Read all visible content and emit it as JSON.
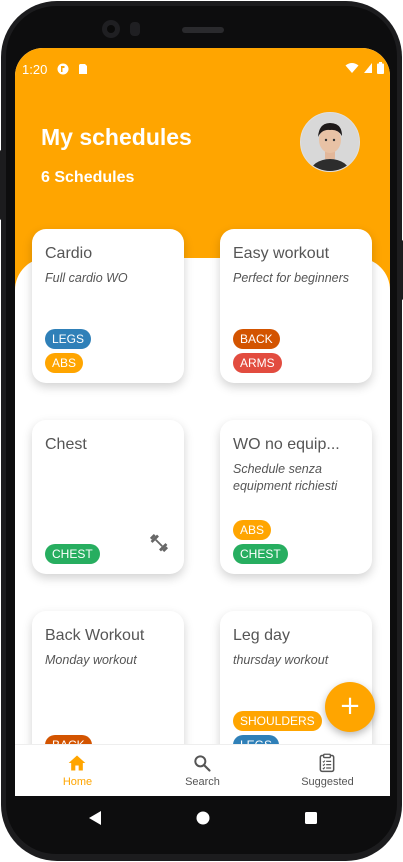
{
  "status_bar": {
    "time": "1:20"
  },
  "header": {
    "title": "My schedules",
    "subtitle": "6 Schedules"
  },
  "cards": [
    {
      "title": "Cardio",
      "description": "Full cardio WO",
      "tags": [
        {
          "label": "LEGS",
          "color": "#2f80b8"
        },
        {
          "label": "ABS",
          "color": "#ffa500"
        }
      ]
    },
    {
      "title": "Easy workout",
      "description": "Perfect for beginners",
      "tags": [
        {
          "label": "BACK",
          "color": "#d35400"
        },
        {
          "label": "ARMS",
          "color": "#e24c3f"
        }
      ]
    },
    {
      "title": "Chest",
      "description": "",
      "tags": [
        {
          "label": "CHEST",
          "color": "#27ae60"
        }
      ],
      "icon": "dumbbell-icon"
    },
    {
      "title": "WO no equip...",
      "description": "Schedule senza equipment richiesti",
      "tags": [
        {
          "label": "ABS",
          "color": "#ffa500"
        },
        {
          "label": "CHEST",
          "color": "#27ae60"
        }
      ]
    },
    {
      "title": "Back Workout",
      "description": "Monday workout",
      "tags": [
        {
          "label": "BACK",
          "color": "#d35400"
        }
      ]
    },
    {
      "title": "Leg day",
      "description": "thursday workout",
      "tags": [
        {
          "label": "SHOULDERS",
          "color": "#ffa500"
        },
        {
          "label": "LEGS",
          "color": "#2f80b8"
        }
      ]
    }
  ],
  "fab": {
    "label": "+"
  },
  "bottom_nav": {
    "items": [
      {
        "label": "Home",
        "icon": "home-icon",
        "active": true
      },
      {
        "label": "Search",
        "icon": "search-icon",
        "active": false
      },
      {
        "label": "Suggested",
        "icon": "clipboard-icon",
        "active": false
      }
    ]
  },
  "colors": {
    "accent": "#ffa500",
    "inactive": "#666666"
  }
}
